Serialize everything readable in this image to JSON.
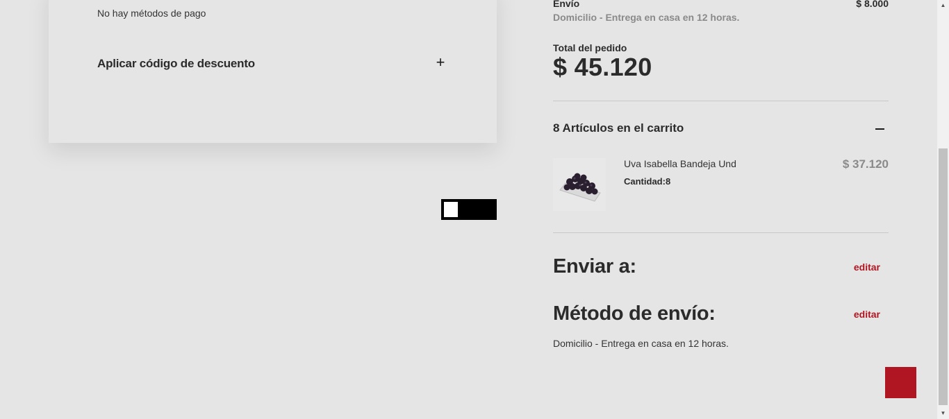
{
  "payment": {
    "no_methods_text": "No hay métodos de pago",
    "discount_label": "Aplicar código de descuento",
    "expand_icon": "plus-icon"
  },
  "summary": {
    "shipping_label": "Envío",
    "shipping_price": "$ 8.000",
    "shipping_method": "Domicilio - Entrega en casa en 12 horas.",
    "total_label": "Total del pedido",
    "total_value": "$ 45.120",
    "cart_title": "8 Artículos en el carrito",
    "collapse_icon": "minus-icon",
    "items": [
      {
        "name": "Uva Isabella Bandeja Und",
        "quantity": "Cantidad:8",
        "price": "$ 37.120"
      }
    ]
  },
  "ship_to": {
    "heading": "Enviar a:",
    "edit_label": "editar"
  },
  "shipping_method_section": {
    "heading": "Método de envío:",
    "edit_label": "editar",
    "method_text": "Domicilio - Entrega en casa en 12 horas."
  },
  "colors": {
    "accent": "#b01622",
    "background": "#e5e5e5",
    "muted_text": "#8a8a8a"
  }
}
